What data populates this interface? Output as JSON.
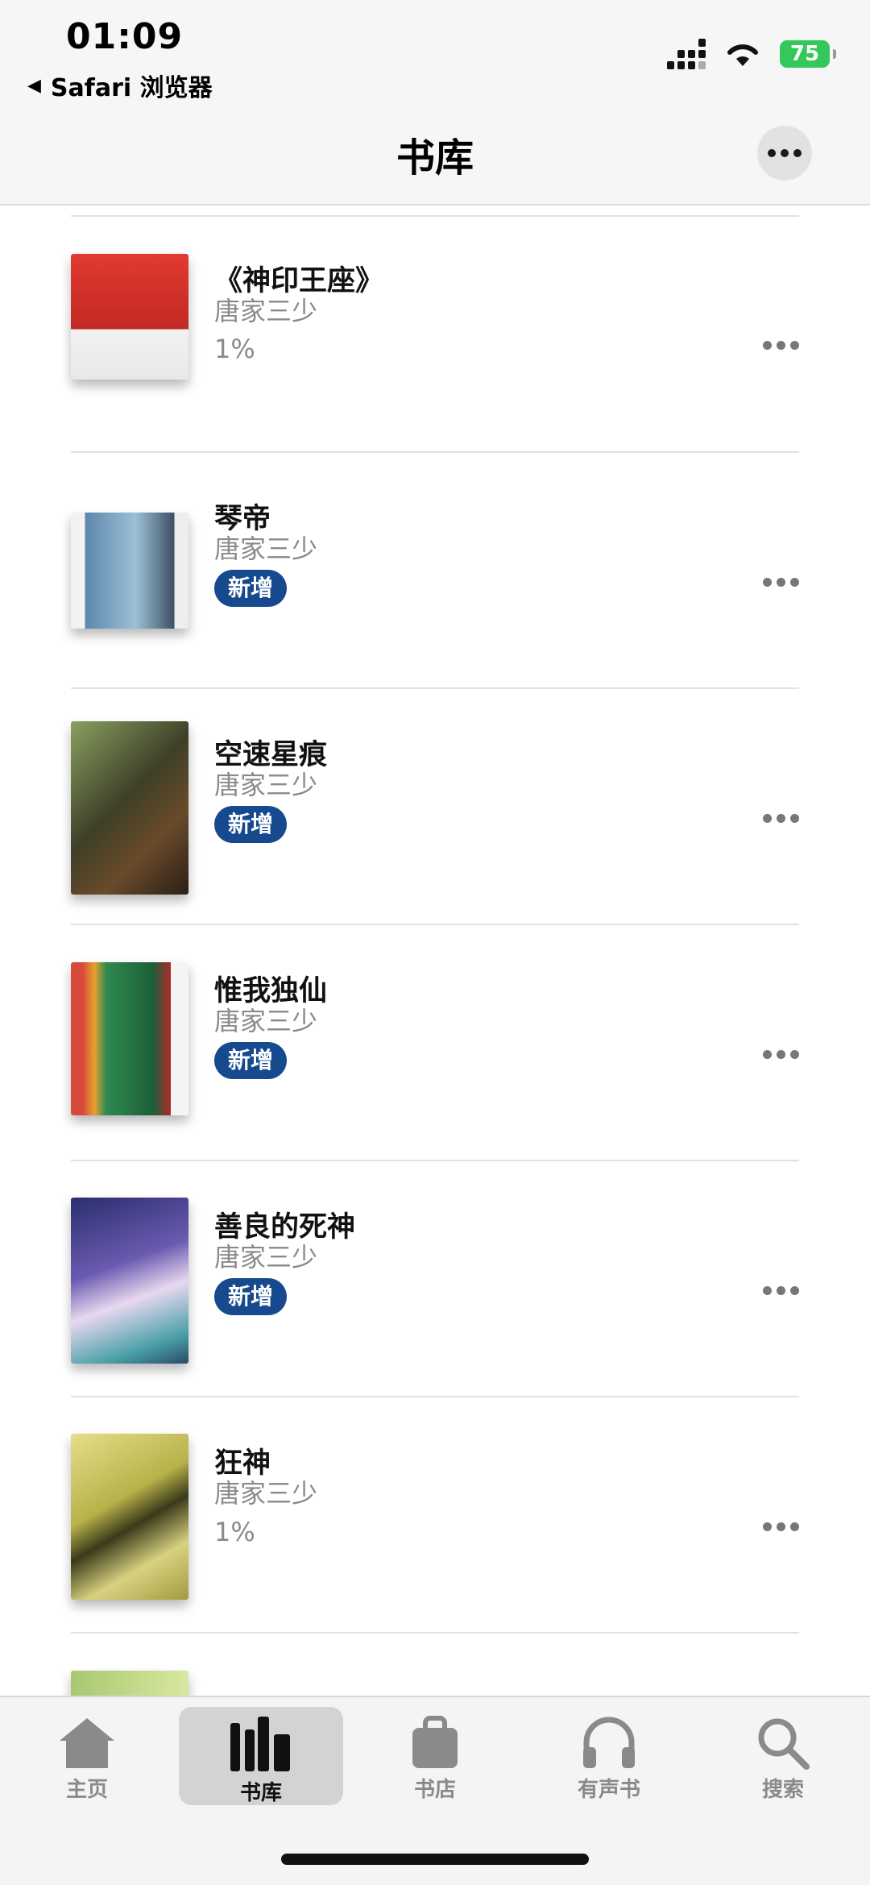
{
  "status_bar": {
    "time": "01:09",
    "back_app": "Safari 浏览器",
    "battery": "75"
  },
  "nav": {
    "title": "书库"
  },
  "books": [
    {
      "title": "《神印王座》",
      "author": "唐家三少",
      "progress": "1%",
      "badge": null,
      "cover_color": "#d3322c"
    },
    {
      "title": "琴帝",
      "author": "唐家三少",
      "progress": null,
      "badge": "新增",
      "cover_color": "#6a8fae"
    },
    {
      "title": "空速星痕",
      "author": "唐家三少",
      "progress": null,
      "badge": "新增",
      "cover_color": "#5a5a32"
    },
    {
      "title": "惟我独仙",
      "author": "唐家三少",
      "progress": null,
      "badge": "新增",
      "cover_color": "#2f7a4a"
    },
    {
      "title": "善良的死神",
      "author": "唐家三少",
      "progress": null,
      "badge": "新增",
      "cover_color": "#3a3e8f"
    },
    {
      "title": "狂神",
      "author": "唐家三少",
      "progress": "1%",
      "badge": null,
      "cover_color": "#b8b24a"
    }
  ],
  "tabs": [
    {
      "label": "主页",
      "icon": "home-icon"
    },
    {
      "label": "书库",
      "icon": "library-icon",
      "active": true
    },
    {
      "label": "书店",
      "icon": "store-bag-icon"
    },
    {
      "label": "有声书",
      "icon": "headphones-icon"
    },
    {
      "label": "搜索",
      "icon": "search-icon"
    }
  ]
}
